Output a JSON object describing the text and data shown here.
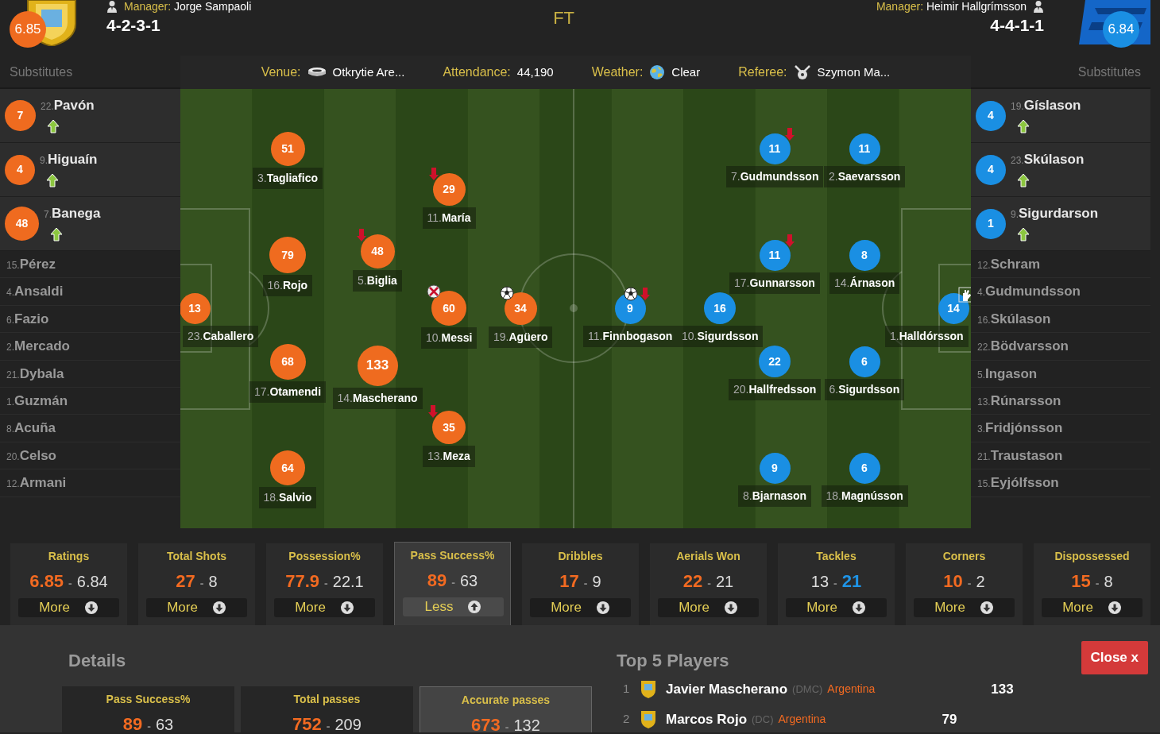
{
  "header": {
    "home": {
      "rating": "6.85",
      "manager_label": "Manager:",
      "manager": "Jorge Sampaoli",
      "formation": "4-2-3-1"
    },
    "status": "FT",
    "away": {
      "rating": "6.84",
      "manager_label": "Manager:",
      "manager": "Heimir Hallgrímsson",
      "formation": "4-4-1-1"
    }
  },
  "info": [
    {
      "kind": "venue",
      "label": "Venue:",
      "value": "Otkrytie Are..."
    },
    {
      "kind": "attendance",
      "label": "Attendance:",
      "value": "44,190"
    },
    {
      "kind": "weather",
      "label": "Weather:",
      "value": "Clear"
    },
    {
      "kind": "referee",
      "label": "Referee:",
      "value": "Szymon Ma..."
    }
  ],
  "home_substitutes": {
    "title": "Substitutes",
    "players": [
      {
        "number": "22.",
        "name": "Pavón",
        "rating": "7",
        "subbed_on": true
      },
      {
        "number": "9.",
        "name": "Higuaín",
        "rating": "4",
        "subbed_on": true
      },
      {
        "number": "7.",
        "name": "Banega",
        "rating": "48",
        "subbed_on": true
      },
      {
        "number": "15.",
        "name": "Pérez",
        "subbed_on": false
      },
      {
        "number": "4.",
        "name": "Ansaldi",
        "subbed_on": false
      },
      {
        "number": "6.",
        "name": "Fazio",
        "subbed_on": false
      },
      {
        "number": "2.",
        "name": "Mercado",
        "subbed_on": false
      },
      {
        "number": "21.",
        "name": "Dybala",
        "subbed_on": false
      },
      {
        "number": "1.",
        "name": "Guzmán",
        "subbed_on": false
      },
      {
        "number": "8.",
        "name": "Acuña",
        "subbed_on": false
      },
      {
        "number": "20.",
        "name": "Celso",
        "subbed_on": false
      },
      {
        "number": "12.",
        "name": "Armani",
        "subbed_on": false
      }
    ]
  },
  "away_substitutes": {
    "title": "Substitutes",
    "players": [
      {
        "number": "19.",
        "name": "Gíslason",
        "rating": "4",
        "subbed_on": true
      },
      {
        "number": "23.",
        "name": "Skúlason",
        "rating": "4",
        "subbed_on": true
      },
      {
        "number": "9.",
        "name": "Sigurdarson",
        "rating": "1",
        "subbed_on": true
      },
      {
        "number": "12.",
        "name": "Schram",
        "subbed_on": false
      },
      {
        "number": "4.",
        "name": "Gudmundsson",
        "subbed_on": false
      },
      {
        "number": "16.",
        "name": "Skúlason",
        "subbed_on": false
      },
      {
        "number": "22.",
        "name": "Bödvarsson",
        "subbed_on": false
      },
      {
        "number": "5.",
        "name": "Ingason",
        "subbed_on": false
      },
      {
        "number": "13.",
        "name": "Rúnarsson",
        "subbed_on": false
      },
      {
        "number": "3.",
        "name": "Fridjónsson",
        "subbed_on": false
      },
      {
        "number": "21.",
        "name": "Traustason",
        "subbed_on": false
      },
      {
        "number": "15.",
        "name": "Eyjólfsson",
        "subbed_on": false
      }
    ]
  },
  "home_lines": [
    [
      {
        "number": "23.",
        "name": "Caballero",
        "rating": "13"
      }
    ],
    [
      {
        "number": "3.",
        "name": "Tagliafico",
        "rating": "51"
      },
      {
        "number": "16.",
        "name": "Rojo",
        "rating": "79"
      },
      {
        "number": "17.",
        "name": "Otamendi",
        "rating": "68"
      },
      {
        "number": "18.",
        "name": "Salvio",
        "rating": "64"
      }
    ],
    [
      {
        "number": "5.",
        "name": "Biglia",
        "rating": "48",
        "events": [
          {
            "kind": "sub_off"
          }
        ]
      },
      {
        "number": "14.",
        "name": "Mascherano",
        "rating": "133"
      }
    ],
    [
      {
        "number": "11.",
        "name": "María",
        "rating": "29",
        "events": [
          {
            "kind": "sub_off"
          }
        ]
      },
      {
        "number": "10.",
        "name": "Messi",
        "rating": "60",
        "events": [
          {
            "kind": "missed_penalty"
          }
        ]
      },
      {
        "number": "13.",
        "name": "Meza",
        "rating": "35",
        "events": [
          {
            "kind": "sub_off"
          }
        ]
      }
    ],
    [
      {
        "number": "19.",
        "name": "Agüero",
        "rating": "34",
        "events": [
          {
            "kind": "goal"
          }
        ]
      }
    ]
  ],
  "away_lines": [
    [
      {
        "number": "11.",
        "name": "Finnbogason",
        "rating": "9",
        "events": [
          {
            "kind": "goal"
          },
          {
            "kind": "sub_off"
          }
        ]
      }
    ],
    [
      {
        "number": "10.",
        "name": "Sigurdsson",
        "rating": "16"
      }
    ],
    [
      {
        "number": "7.",
        "name": "Gudmundsson",
        "rating": "11",
        "events": [
          {
            "kind": "sub_off"
          }
        ]
      },
      {
        "number": "17.",
        "name": "Gunnarsson",
        "rating": "11",
        "events": [
          {
            "kind": "sub_off"
          }
        ]
      },
      {
        "number": "20.",
        "name": "Hallfredsson",
        "rating": "22"
      },
      {
        "number": "8.",
        "name": "Bjarnason",
        "rating": "9"
      }
    ],
    [
      {
        "number": "2.",
        "name": "Saevarsson",
        "rating": "11"
      },
      {
        "number": "14.",
        "name": "Árnason",
        "rating": "8"
      },
      {
        "number": "6.",
        "name": "Sigurdsson",
        "rating": "6"
      },
      {
        "number": "18.",
        "name": "Magnússon",
        "rating": "6"
      }
    ],
    [
      {
        "number": "1.",
        "name": "Halldórsson",
        "rating": "14",
        "events": [
          {
            "kind": "save"
          }
        ]
      }
    ]
  ],
  "value_separator": "-",
  "stats": [
    {
      "title": "Ratings",
      "home": "6.85",
      "away": "6.84",
      "home_highlighted": true,
      "away_highlighted": false,
      "button": "More",
      "selected": false
    },
    {
      "title": "Total Shots",
      "home": "27",
      "away": "8",
      "home_highlighted": true,
      "away_highlighted": false,
      "button": "More",
      "selected": false
    },
    {
      "title": "Possession%",
      "home": "77.9",
      "away": "22.1",
      "home_highlighted": true,
      "away_highlighted": false,
      "button": "More",
      "selected": false
    },
    {
      "title": "Pass Success%",
      "home": "89",
      "away": "63",
      "home_highlighted": true,
      "away_highlighted": false,
      "button": "Less",
      "selected": true
    },
    {
      "title": "Dribbles",
      "home": "17",
      "away": "9",
      "home_highlighted": true,
      "away_highlighted": false,
      "button": "More",
      "selected": false
    },
    {
      "title": "Aerials Won",
      "home": "22",
      "away": "21",
      "home_highlighted": true,
      "away_highlighted": false,
      "button": "More",
      "selected": false
    },
    {
      "title": "Tackles",
      "home": "13",
      "away": "21",
      "home_highlighted": false,
      "away_highlighted": true,
      "button": "More",
      "selected": false
    },
    {
      "title": "Corners",
      "home": "10",
      "away": "2",
      "home_highlighted": true,
      "away_highlighted": false,
      "button": "More",
      "selected": false
    },
    {
      "title": "Dispossessed",
      "home": "15",
      "away": "8",
      "home_highlighted": true,
      "away_highlighted": false,
      "button": "More",
      "selected": false
    }
  ],
  "details": {
    "title": "Details",
    "cards": [
      {
        "title": "Pass Success%",
        "home": "89",
        "away": "63",
        "home_highlighted": true,
        "away_highlighted": false,
        "selected": false
      },
      {
        "title": "Total passes",
        "home": "752",
        "away": "209",
        "home_highlighted": true,
        "away_highlighted": false,
        "selected": false
      },
      {
        "title": "Accurate passes",
        "home": "673",
        "away": "132",
        "home_highlighted": true,
        "away_highlighted": false,
        "selected": true
      }
    ]
  },
  "top_players": {
    "title": "Top 5 Players",
    "close": "Close x",
    "rows": [
      {
        "rank": "1",
        "name": "Javier Mascherano",
        "position": "(DMC)",
        "team": "Argentina",
        "rating": "133"
      },
      {
        "rank": "2",
        "name": "Marcos Rojo",
        "position": "(DC)",
        "team": "Argentina",
        "rating": "79"
      }
    ]
  }
}
